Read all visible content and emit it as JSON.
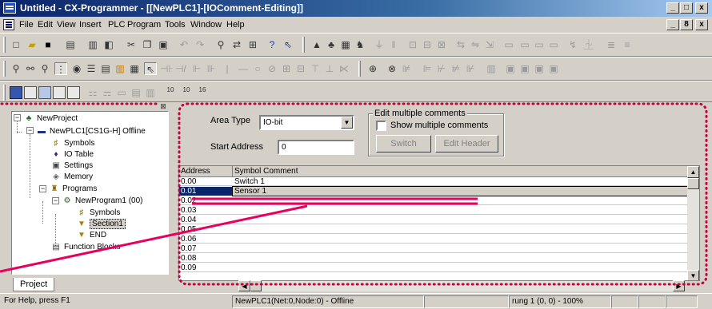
{
  "window": {
    "title": "Untitled - CX-Programmer - [[NewPLC1]-[IOComment-Editing]]",
    "caption_buttons": [
      "_",
      "□",
      "x"
    ],
    "doc_buttons": [
      "_",
      "8",
      "x"
    ]
  },
  "menu": [
    "File",
    "Edit",
    "View",
    "Insert",
    "PLC",
    "Program",
    "Tools",
    "Window",
    "Help"
  ],
  "toolbar2": {
    "zoom_labels": [
      "10",
      "10",
      "16"
    ]
  },
  "project_tree": {
    "tab_label": "Project",
    "nodes": [
      {
        "label": "NewProject"
      },
      {
        "label": "NewPLC1[CS1G-H] Offline"
      },
      {
        "label": "Symbols"
      },
      {
        "label": "IO Table"
      },
      {
        "label": "Settings"
      },
      {
        "label": "Memory"
      },
      {
        "label": "Programs"
      },
      {
        "label": "NewProgram1 (00)"
      },
      {
        "label": "Symbols"
      },
      {
        "label": "Section1"
      },
      {
        "label": "END"
      },
      {
        "label": "Function Blocks"
      }
    ]
  },
  "io_comment": {
    "area_type_label": "Area Type",
    "area_type_value": "IO-bit",
    "start_address_label": "Start Address",
    "start_address_value": "0",
    "group_title": "Edit multiple comments",
    "show_multiple_label": "Show multiple comments",
    "switch_button": "Switch",
    "edit_header_button": "Edit Header",
    "columns": [
      "Address",
      "Symbol Comment"
    ],
    "rows": [
      {
        "address": "0.00",
        "comment": "Switch 1"
      },
      {
        "address": "0.01",
        "comment": "Sensor 1"
      },
      {
        "address": "0.02",
        "comment": ""
      },
      {
        "address": "0.03",
        "comment": ""
      },
      {
        "address": "0.04",
        "comment": ""
      },
      {
        "address": "0.05",
        "comment": ""
      },
      {
        "address": "0.06",
        "comment": ""
      },
      {
        "address": "0.07",
        "comment": ""
      },
      {
        "address": "0.08",
        "comment": ""
      },
      {
        "address": "0.09",
        "comment": ""
      }
    ],
    "selected_row_address": "0.01"
  },
  "status": {
    "help": "For Help, press F1",
    "connection": "NewPLC1(Net:0,Node:0) - Offline",
    "position": "rung 1 (0, 0)  - 100%"
  },
  "colors": {
    "annotation_line": "#e8005e",
    "annotation_dots": "#c8003c",
    "selection": "#0a246a",
    "face": "#d4d0c8"
  }
}
